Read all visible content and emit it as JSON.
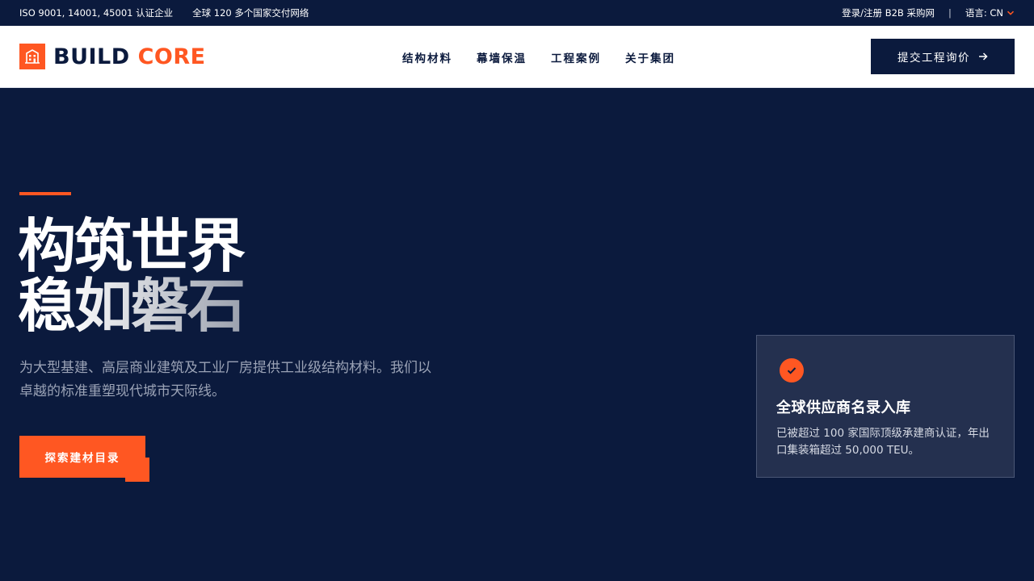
{
  "topbar": {
    "cert": "ISO 9001, 14001, 45001 认证企业",
    "network": "全球 120 多个国家交付网络",
    "login": "登录/注册 B2B 采购网",
    "separator": "|",
    "language": "语言: CN"
  },
  "brand": {
    "name_part1": "BUILD",
    "name_part2": "CORE",
    "accent_color": "#ff5722",
    "primary_color": "#0b1a3d"
  },
  "nav": {
    "items": [
      {
        "label": "结构材料"
      },
      {
        "label": "幕墙保温"
      },
      {
        "label": "工程案例"
      },
      {
        "label": "关于集团"
      }
    ],
    "cta_label": "提交工程询价"
  },
  "hero": {
    "title_line1": "构筑世界",
    "title_line2": "稳如磐石",
    "description": "为大型基建、高层商业建筑及工业厂房提供工业级结构材料。我们以卓越的标准重塑现代城市天际线。",
    "button_label": "探索建材目录"
  },
  "card": {
    "icon": "check-circle-icon",
    "title": "全球供应商名录入库",
    "text": "已被超过 100 家国际顶级承建商认证，年出口集装箱超过 50,000 TEU。"
  }
}
